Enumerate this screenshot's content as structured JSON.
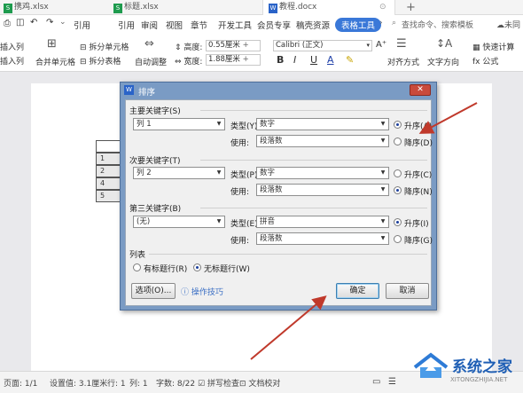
{
  "tabs": [
    {
      "label": "携鸡.xlsx",
      "kind": "xls"
    },
    {
      "label": "标题.xlsx",
      "kind": "xls"
    },
    {
      "label": "教程.docx",
      "kind": "doc",
      "active": true
    }
  ],
  "menu": [
    "引用",
    "审阅",
    "视图",
    "章节",
    "开发工具",
    "会员专享",
    "稿壳资源",
    "表格工具"
  ],
  "menu_partial": "引用",
  "menu_highlight": "表格工具",
  "search_placeholder": "查找命令、搜索模板",
  "sync_label": "未同",
  "ribbon": {
    "insert_col": "插入列",
    "insert_col2": "插入列",
    "merge": "合并单元格",
    "split_cell": "拆分单元格",
    "split_table": "拆分表格",
    "autofit": "自动调整",
    "height_label": "高度:",
    "height_value": "0.55厘米",
    "width_label": "宽度:",
    "width_value": "1.88厘米",
    "font": "Calibri (正文)",
    "bold": "B",
    "italic": "I",
    "underline": "U",
    "align": "对齐方式",
    "text_dir": "文字方向",
    "quick_calc": "快速计算",
    "formula": "fx 公式"
  },
  "table_rows": [
    "1",
    "2",
    "4",
    "5"
  ],
  "dialog": {
    "title": "排序",
    "close": "✕",
    "primary_group": "主要关键字(S)",
    "primary_key": "列 1",
    "type_label_1": "类型(Y):",
    "type_value_1": "数字",
    "use_label_1": "使用:",
    "use_value_1": "段落数",
    "asc_1": "升序(A)",
    "desc_1": "降序(D)",
    "secondary_group": "次要关键字(T)",
    "secondary_key": "列 2",
    "type_label_2": "类型(P):",
    "type_value_2": "数字",
    "use_label_2": "使用:",
    "use_value_2": "段落数",
    "asc_2": "升序(C)",
    "desc_2": "降序(N)",
    "third_group": "第三关键字(B)",
    "third_key": "(无)",
    "type_label_3": "类型(E):",
    "type_value_3": "拼音",
    "use_label_3": "使用:",
    "use_value_3": "段落数",
    "asc_3": "升序(I)",
    "desc_3": "降序(G)",
    "list_group": "列表",
    "has_header": "有标题行(R)",
    "no_header": "无标题行(W)",
    "options": "选项(O)...",
    "tips": "操作技巧",
    "ok": "确定",
    "cancel": "取消"
  },
  "status": {
    "page": "页面: 1/1",
    "set": "设置值: 3.1厘米",
    "row": "行: 1",
    "col": "列: 1",
    "words": "字数: 8/22",
    "spell": "拼写检查",
    "proof": "文档校对"
  },
  "watermark": {
    "brand": "系统之家",
    "url": "XITONGZHIJIA.NET"
  },
  "colors": {
    "accent": "#3a78d8",
    "arrow": "#c0392b",
    "dialog_frame": "#7a9bc4"
  }
}
